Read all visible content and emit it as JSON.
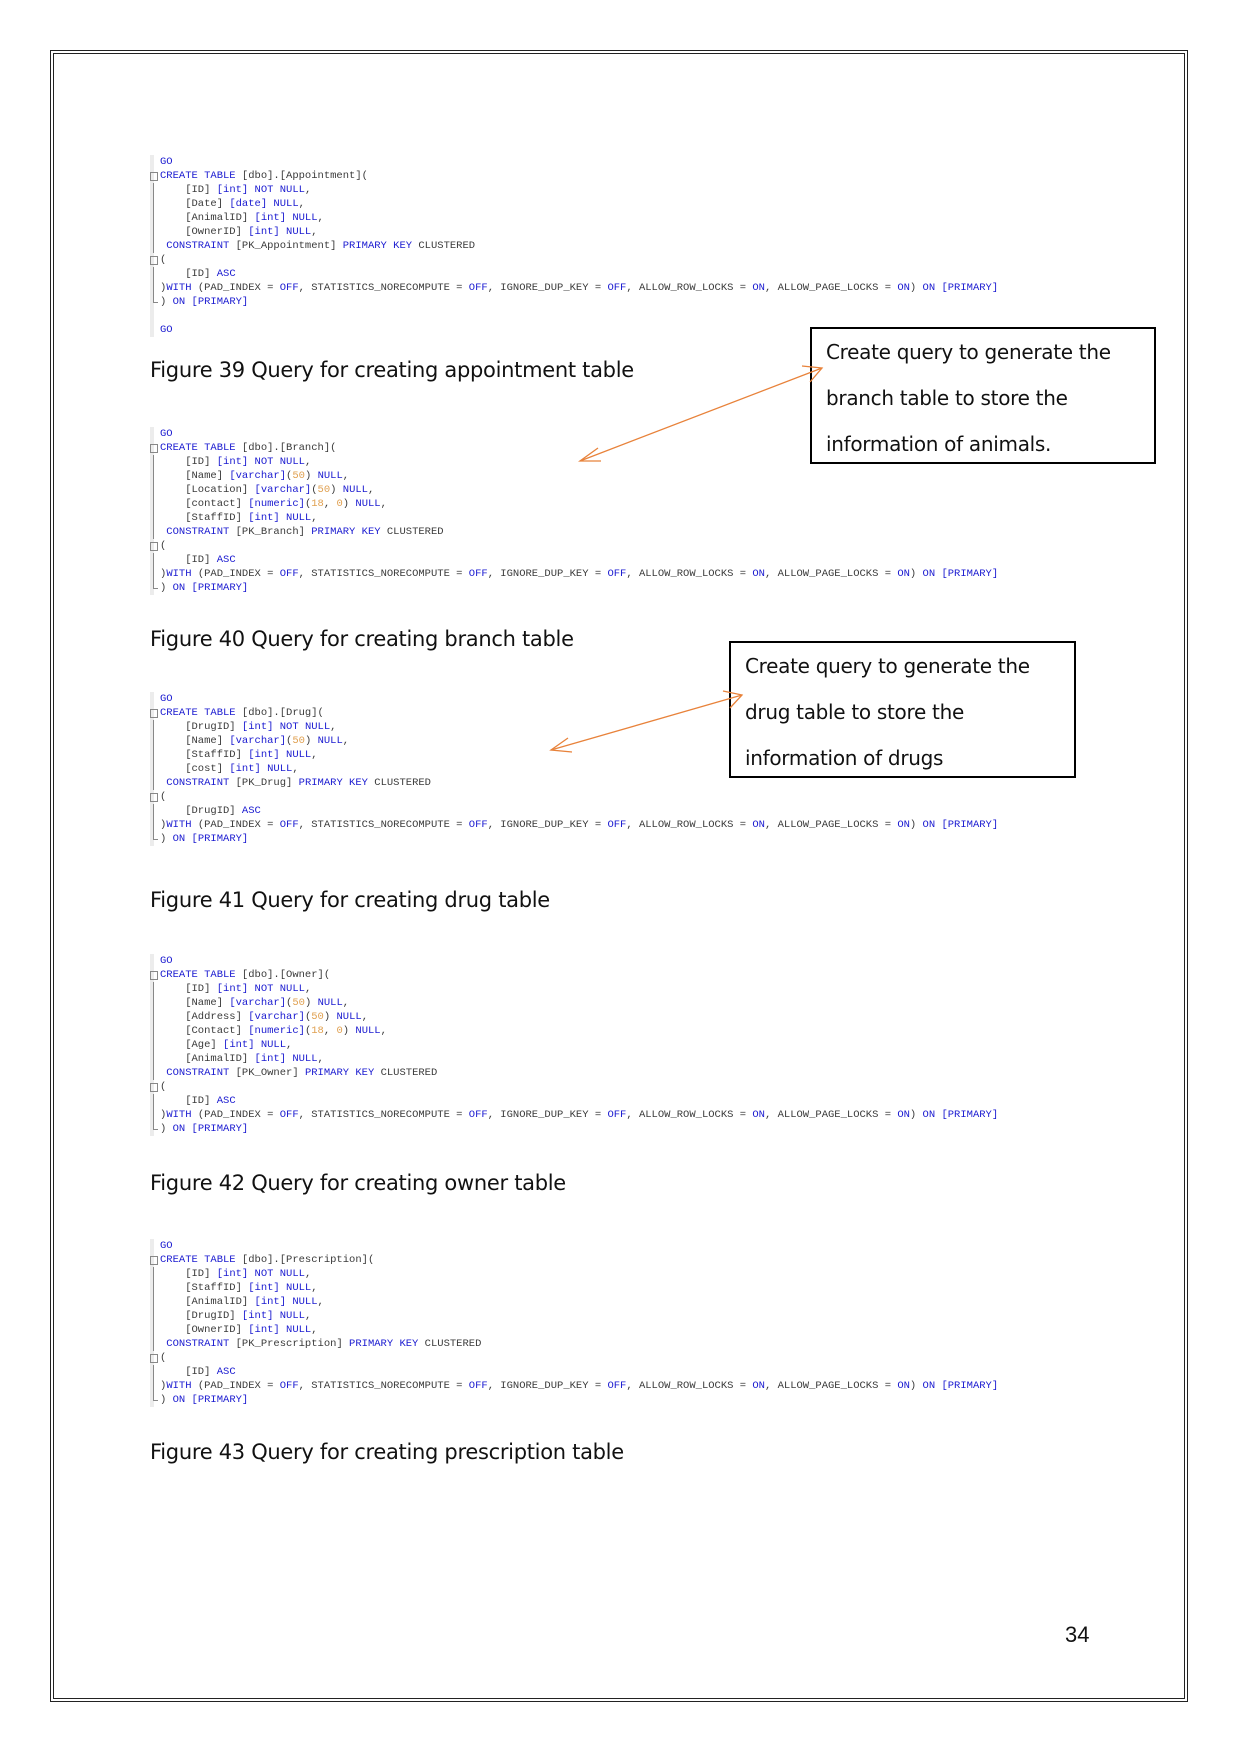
{
  "page_number": "34",
  "figures": [
    {
      "caption": "Figure 39 Query for creating appointment table",
      "code": [
        [
          {
            "t": "GO",
            "c": "kw"
          }
        ],
        [
          {
            "t": "CREATE TABLE ",
            "c": "kw"
          },
          {
            "t": "[dbo].[Appointment]("
          }
        ],
        [
          {
            "t": "    [ID] "
          },
          {
            "t": "[int] ",
            "c": "kw"
          },
          {
            "t": "NOT NULL",
            "c": "kw"
          },
          {
            "t": ","
          }
        ],
        [
          {
            "t": "    [Date] "
          },
          {
            "t": "[date] ",
            "c": "kw"
          },
          {
            "t": "NULL",
            "c": "kw"
          },
          {
            "t": ","
          }
        ],
        [
          {
            "t": "    [AnimalID] "
          },
          {
            "t": "[int] ",
            "c": "kw"
          },
          {
            "t": "NULL",
            "c": "kw"
          },
          {
            "t": ","
          }
        ],
        [
          {
            "t": "    [OwnerID] "
          },
          {
            "t": "[int] ",
            "c": "kw"
          },
          {
            "t": "NULL",
            "c": "kw"
          },
          {
            "t": ","
          }
        ],
        [
          {
            "t": " CONSTRAINT ",
            "c": "kw"
          },
          {
            "t": "[PK_Appointment] "
          },
          {
            "t": "PRIMARY KEY ",
            "c": "kw"
          },
          {
            "t": "CLUSTERED"
          }
        ],
        [
          {
            "t": "("
          }
        ],
        [
          {
            "t": "    [ID] "
          },
          {
            "t": "ASC",
            "c": "kw"
          }
        ],
        [
          {
            "t": ")"
          },
          {
            "t": "WITH ",
            "c": "kw"
          },
          {
            "t": "(PAD_INDEX = "
          },
          {
            "t": "OFF",
            "c": "kw"
          },
          {
            "t": ", STATISTICS_NORECOMPUTE = "
          },
          {
            "t": "OFF",
            "c": "kw"
          },
          {
            "t": ", IGNORE_DUP_KEY = "
          },
          {
            "t": "OFF",
            "c": "kw"
          },
          {
            "t": ", ALLOW_ROW_LOCKS = "
          },
          {
            "t": "ON",
            "c": "kw"
          },
          {
            "t": ", ALLOW_PAGE_LOCKS = "
          },
          {
            "t": "ON",
            "c": "kw"
          },
          {
            "t": ") "
          },
          {
            "t": "ON ",
            "c": "kw"
          },
          {
            "t": "[PRIMARY]",
            "c": "kw"
          }
        ],
        [
          {
            "t": ") "
          },
          {
            "t": "ON ",
            "c": "kw"
          },
          {
            "t": "[PRIMARY]",
            "c": "kw"
          }
        ],
        [
          {
            "t": ""
          }
        ],
        [
          {
            "t": "GO",
            "c": "kw"
          }
        ]
      ]
    },
    {
      "caption": "Figure 40 Query for creating branch table",
      "code": [
        [
          {
            "t": "GO",
            "c": "kw"
          }
        ],
        [
          {
            "t": "CREATE TABLE ",
            "c": "kw"
          },
          {
            "t": "[dbo].[Branch]("
          }
        ],
        [
          {
            "t": "    [ID] "
          },
          {
            "t": "[int] ",
            "c": "kw"
          },
          {
            "t": "NOT NULL",
            "c": "kw"
          },
          {
            "t": ","
          }
        ],
        [
          {
            "t": "    [Name] "
          },
          {
            "t": "[varchar]",
            "c": "kw"
          },
          {
            "t": "("
          },
          {
            "t": "50",
            "c": "num"
          },
          {
            "t": ") "
          },
          {
            "t": "NULL",
            "c": "kw"
          },
          {
            "t": ","
          }
        ],
        [
          {
            "t": "    [Location] "
          },
          {
            "t": "[varchar]",
            "c": "kw"
          },
          {
            "t": "("
          },
          {
            "t": "50",
            "c": "num"
          },
          {
            "t": ") "
          },
          {
            "t": "NULL",
            "c": "kw"
          },
          {
            "t": ","
          }
        ],
        [
          {
            "t": "    [contact] "
          },
          {
            "t": "[numeric]",
            "c": "kw"
          },
          {
            "t": "("
          },
          {
            "t": "18",
            "c": "num"
          },
          {
            "t": ", "
          },
          {
            "t": "0",
            "c": "num"
          },
          {
            "t": ") "
          },
          {
            "t": "NULL",
            "c": "kw"
          },
          {
            "t": ","
          }
        ],
        [
          {
            "t": "    [StaffID] "
          },
          {
            "t": "[int] ",
            "c": "kw"
          },
          {
            "t": "NULL",
            "c": "kw"
          },
          {
            "t": ","
          }
        ],
        [
          {
            "t": " CONSTRAINT ",
            "c": "kw"
          },
          {
            "t": "[PK_Branch] "
          },
          {
            "t": "PRIMARY KEY ",
            "c": "kw"
          },
          {
            "t": "CLUSTERED"
          }
        ],
        [
          {
            "t": "("
          }
        ],
        [
          {
            "t": "    [ID] "
          },
          {
            "t": "ASC",
            "c": "kw"
          }
        ],
        [
          {
            "t": ")"
          },
          {
            "t": "WITH ",
            "c": "kw"
          },
          {
            "t": "(PAD_INDEX = "
          },
          {
            "t": "OFF",
            "c": "kw"
          },
          {
            "t": ", STATISTICS_NORECOMPUTE = "
          },
          {
            "t": "OFF",
            "c": "kw"
          },
          {
            "t": ", IGNORE_DUP_KEY = "
          },
          {
            "t": "OFF",
            "c": "kw"
          },
          {
            "t": ", ALLOW_ROW_LOCKS = "
          },
          {
            "t": "ON",
            "c": "kw"
          },
          {
            "t": ", ALLOW_PAGE_LOCKS = "
          },
          {
            "t": "ON",
            "c": "kw"
          },
          {
            "t": ") "
          },
          {
            "t": "ON ",
            "c": "kw"
          },
          {
            "t": "[PRIMARY]",
            "c": "kw"
          }
        ],
        [
          {
            "t": ") "
          },
          {
            "t": "ON ",
            "c": "kw"
          },
          {
            "t": "[PRIMARY]",
            "c": "kw"
          }
        ]
      ]
    },
    {
      "caption": "Figure 41 Query for creating drug table",
      "code": [
        [
          {
            "t": "GO",
            "c": "kw"
          }
        ],
        [
          {
            "t": "CREATE TABLE ",
            "c": "kw"
          },
          {
            "t": "[dbo].[Drug]("
          }
        ],
        [
          {
            "t": "    [DrugID] "
          },
          {
            "t": "[int] ",
            "c": "kw"
          },
          {
            "t": "NOT NULL",
            "c": "kw"
          },
          {
            "t": ","
          }
        ],
        [
          {
            "t": "    [Name] "
          },
          {
            "t": "[varchar]",
            "c": "kw"
          },
          {
            "t": "("
          },
          {
            "t": "50",
            "c": "num"
          },
          {
            "t": ") "
          },
          {
            "t": "NULL",
            "c": "kw"
          },
          {
            "t": ","
          }
        ],
        [
          {
            "t": "    [StaffID] "
          },
          {
            "t": "[int] ",
            "c": "kw"
          },
          {
            "t": "NULL",
            "c": "kw"
          },
          {
            "t": ","
          }
        ],
        [
          {
            "t": "    [cost] "
          },
          {
            "t": "[int] ",
            "c": "kw"
          },
          {
            "t": "NULL",
            "c": "kw"
          },
          {
            "t": ","
          }
        ],
        [
          {
            "t": " CONSTRAINT ",
            "c": "kw"
          },
          {
            "t": "[PK_Drug] "
          },
          {
            "t": "PRIMARY KEY ",
            "c": "kw"
          },
          {
            "t": "CLUSTERED"
          }
        ],
        [
          {
            "t": "("
          }
        ],
        [
          {
            "t": "    [DrugID] "
          },
          {
            "t": "ASC",
            "c": "kw"
          }
        ],
        [
          {
            "t": ")"
          },
          {
            "t": "WITH ",
            "c": "kw"
          },
          {
            "t": "(PAD_INDEX = "
          },
          {
            "t": "OFF",
            "c": "kw"
          },
          {
            "t": ", STATISTICS_NORECOMPUTE = "
          },
          {
            "t": "OFF",
            "c": "kw"
          },
          {
            "t": ", IGNORE_DUP_KEY = "
          },
          {
            "t": "OFF",
            "c": "kw"
          },
          {
            "t": ", ALLOW_ROW_LOCKS = "
          },
          {
            "t": "ON",
            "c": "kw"
          },
          {
            "t": ", ALLOW_PAGE_LOCKS = "
          },
          {
            "t": "ON",
            "c": "kw"
          },
          {
            "t": ") "
          },
          {
            "t": "ON ",
            "c": "kw"
          },
          {
            "t": "[PRIMARY]",
            "c": "kw"
          }
        ],
        [
          {
            "t": ") "
          },
          {
            "t": "ON ",
            "c": "kw"
          },
          {
            "t": "[PRIMARY]",
            "c": "kw"
          }
        ]
      ]
    },
    {
      "caption": "Figure 42 Query for creating owner table",
      "code": [
        [
          {
            "t": "GO",
            "c": "kw"
          }
        ],
        [
          {
            "t": "CREATE TABLE ",
            "c": "kw"
          },
          {
            "t": "[dbo].[Owner]("
          }
        ],
        [
          {
            "t": "    [ID] "
          },
          {
            "t": "[int] ",
            "c": "kw"
          },
          {
            "t": "NOT NULL",
            "c": "kw"
          },
          {
            "t": ","
          }
        ],
        [
          {
            "t": "    [Name] "
          },
          {
            "t": "[varchar]",
            "c": "kw"
          },
          {
            "t": "("
          },
          {
            "t": "50",
            "c": "num"
          },
          {
            "t": ") "
          },
          {
            "t": "NULL",
            "c": "kw"
          },
          {
            "t": ","
          }
        ],
        [
          {
            "t": "    [Address] "
          },
          {
            "t": "[varchar]",
            "c": "kw"
          },
          {
            "t": "("
          },
          {
            "t": "50",
            "c": "num"
          },
          {
            "t": ") "
          },
          {
            "t": "NULL",
            "c": "kw"
          },
          {
            "t": ","
          }
        ],
        [
          {
            "t": "    [Contact] "
          },
          {
            "t": "[numeric]",
            "c": "kw"
          },
          {
            "t": "("
          },
          {
            "t": "18",
            "c": "num"
          },
          {
            "t": ", "
          },
          {
            "t": "0",
            "c": "num"
          },
          {
            "t": ") "
          },
          {
            "t": "NULL",
            "c": "kw"
          },
          {
            "t": ","
          }
        ],
        [
          {
            "t": "    [Age] "
          },
          {
            "t": "[int] ",
            "c": "kw"
          },
          {
            "t": "NULL",
            "c": "kw"
          },
          {
            "t": ","
          }
        ],
        [
          {
            "t": "    [AnimalID] "
          },
          {
            "t": "[int] ",
            "c": "kw"
          },
          {
            "t": "NULL",
            "c": "kw"
          },
          {
            "t": ","
          }
        ],
        [
          {
            "t": " CONSTRAINT ",
            "c": "kw"
          },
          {
            "t": "[PK_Owner] "
          },
          {
            "t": "PRIMARY KEY ",
            "c": "kw"
          },
          {
            "t": "CLUSTERED"
          }
        ],
        [
          {
            "t": "("
          }
        ],
        [
          {
            "t": "    [ID] "
          },
          {
            "t": "ASC",
            "c": "kw"
          }
        ],
        [
          {
            "t": ")"
          },
          {
            "t": "WITH ",
            "c": "kw"
          },
          {
            "t": "(PAD_INDEX = "
          },
          {
            "t": "OFF",
            "c": "kw"
          },
          {
            "t": ", STATISTICS_NORECOMPUTE = "
          },
          {
            "t": "OFF",
            "c": "kw"
          },
          {
            "t": ", IGNORE_DUP_KEY = "
          },
          {
            "t": "OFF",
            "c": "kw"
          },
          {
            "t": ", ALLOW_ROW_LOCKS = "
          },
          {
            "t": "ON",
            "c": "kw"
          },
          {
            "t": ", ALLOW_PAGE_LOCKS = "
          },
          {
            "t": "ON",
            "c": "kw"
          },
          {
            "t": ") "
          },
          {
            "t": "ON ",
            "c": "kw"
          },
          {
            "t": "[PRIMARY]",
            "c": "kw"
          }
        ],
        [
          {
            "t": ") "
          },
          {
            "t": "ON ",
            "c": "kw"
          },
          {
            "t": "[PRIMARY]",
            "c": "kw"
          }
        ]
      ]
    },
    {
      "caption": "Figure 43 Query for creating prescription table",
      "code": [
        [
          {
            "t": "GO",
            "c": "kw"
          }
        ],
        [
          {
            "t": "CREATE TABLE ",
            "c": "kw"
          },
          {
            "t": "[dbo].[Prescription]("
          }
        ],
        [
          {
            "t": "    [ID] "
          },
          {
            "t": "[int] ",
            "c": "kw"
          },
          {
            "t": "NOT NULL",
            "c": "kw"
          },
          {
            "t": ","
          }
        ],
        [
          {
            "t": "    [StaffID] "
          },
          {
            "t": "[int] ",
            "c": "kw"
          },
          {
            "t": "NULL",
            "c": "kw"
          },
          {
            "t": ","
          }
        ],
        [
          {
            "t": "    [AnimalID] "
          },
          {
            "t": "[int] ",
            "c": "kw"
          },
          {
            "t": "NULL",
            "c": "kw"
          },
          {
            "t": ","
          }
        ],
        [
          {
            "t": "    [DrugID] "
          },
          {
            "t": "[int] ",
            "c": "kw"
          },
          {
            "t": "NULL",
            "c": "kw"
          },
          {
            "t": ","
          }
        ],
        [
          {
            "t": "    [OwnerID] "
          },
          {
            "t": "[int] ",
            "c": "kw"
          },
          {
            "t": "NULL",
            "c": "kw"
          },
          {
            "t": ","
          }
        ],
        [
          {
            "t": " CONSTRAINT ",
            "c": "kw"
          },
          {
            "t": "[PK_Prescription] "
          },
          {
            "t": "PRIMARY KEY ",
            "c": "kw"
          },
          {
            "t": "CLUSTERED"
          }
        ],
        [
          {
            "t": "("
          }
        ],
        [
          {
            "t": "    [ID] "
          },
          {
            "t": "ASC",
            "c": "kw"
          }
        ],
        [
          {
            "t": ")"
          },
          {
            "t": "WITH ",
            "c": "kw"
          },
          {
            "t": "(PAD_INDEX = "
          },
          {
            "t": "OFF",
            "c": "kw"
          },
          {
            "t": ", STATISTICS_NORECOMPUTE = "
          },
          {
            "t": "OFF",
            "c": "kw"
          },
          {
            "t": ", IGNORE_DUP_KEY = "
          },
          {
            "t": "OFF",
            "c": "kw"
          },
          {
            "t": ", ALLOW_ROW_LOCKS = "
          },
          {
            "t": "ON",
            "c": "kw"
          },
          {
            "t": ", ALLOW_PAGE_LOCKS = "
          },
          {
            "t": "ON",
            "c": "kw"
          },
          {
            "t": ") "
          },
          {
            "t": "ON ",
            "c": "kw"
          },
          {
            "t": "[PRIMARY]",
            "c": "kw"
          }
        ],
        [
          {
            "t": ") "
          },
          {
            "t": "ON ",
            "c": "kw"
          },
          {
            "t": "[PRIMARY]",
            "c": "kw"
          }
        ]
      ]
    }
  ],
  "callouts": [
    {
      "lines": [
        "Create query to generate the",
        "branch table to store the",
        "information of animals."
      ]
    },
    {
      "lines": [
        "Create query to generate the",
        "drug table to store the",
        "information of drugs"
      ]
    }
  ],
  "colors": {
    "keyword": "#1a1ad0",
    "identifier": "#3a3a3a",
    "number": "#e0a050",
    "arrow": "#e8823a"
  }
}
